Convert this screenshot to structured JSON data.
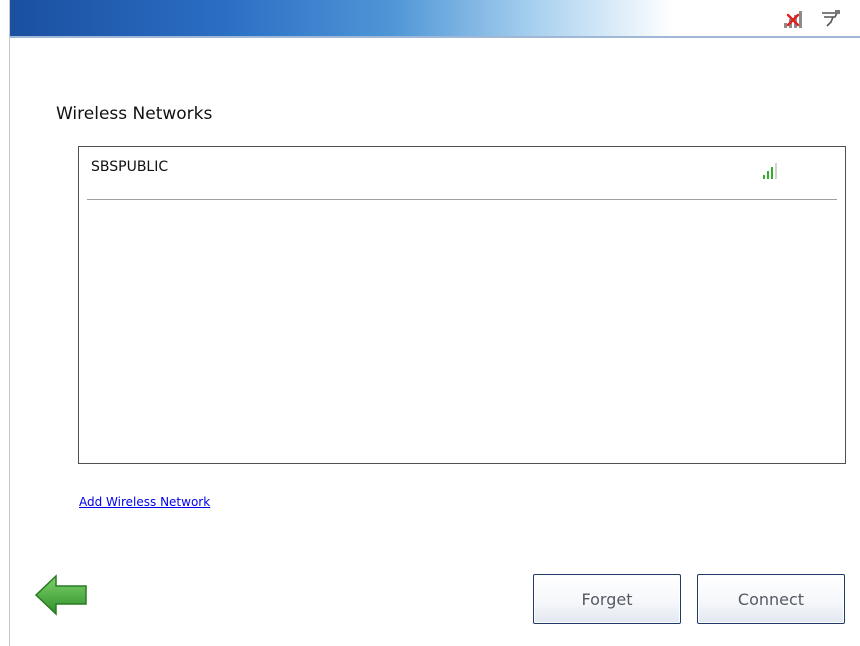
{
  "header": {
    "icons": [
      "network-disconnected-icon",
      "wired-plug-icon"
    ]
  },
  "main": {
    "title": "Wireless Networks",
    "networks": [
      {
        "ssid": "SBSPUBLIC",
        "signal_icon": "wifi-signal-icon",
        "signal_color": "#2fb12f"
      }
    ],
    "add_link": "Add Wireless Network"
  },
  "footer": {
    "back_icon": "back-arrow-icon",
    "forget_label": "Forget",
    "connect_label": "Connect"
  },
  "colors": {
    "banner_dark": "#1b4f9f",
    "banner_light": "#a9d1ef",
    "link": "#0000ee",
    "back_arrow": "#3fa33a"
  }
}
